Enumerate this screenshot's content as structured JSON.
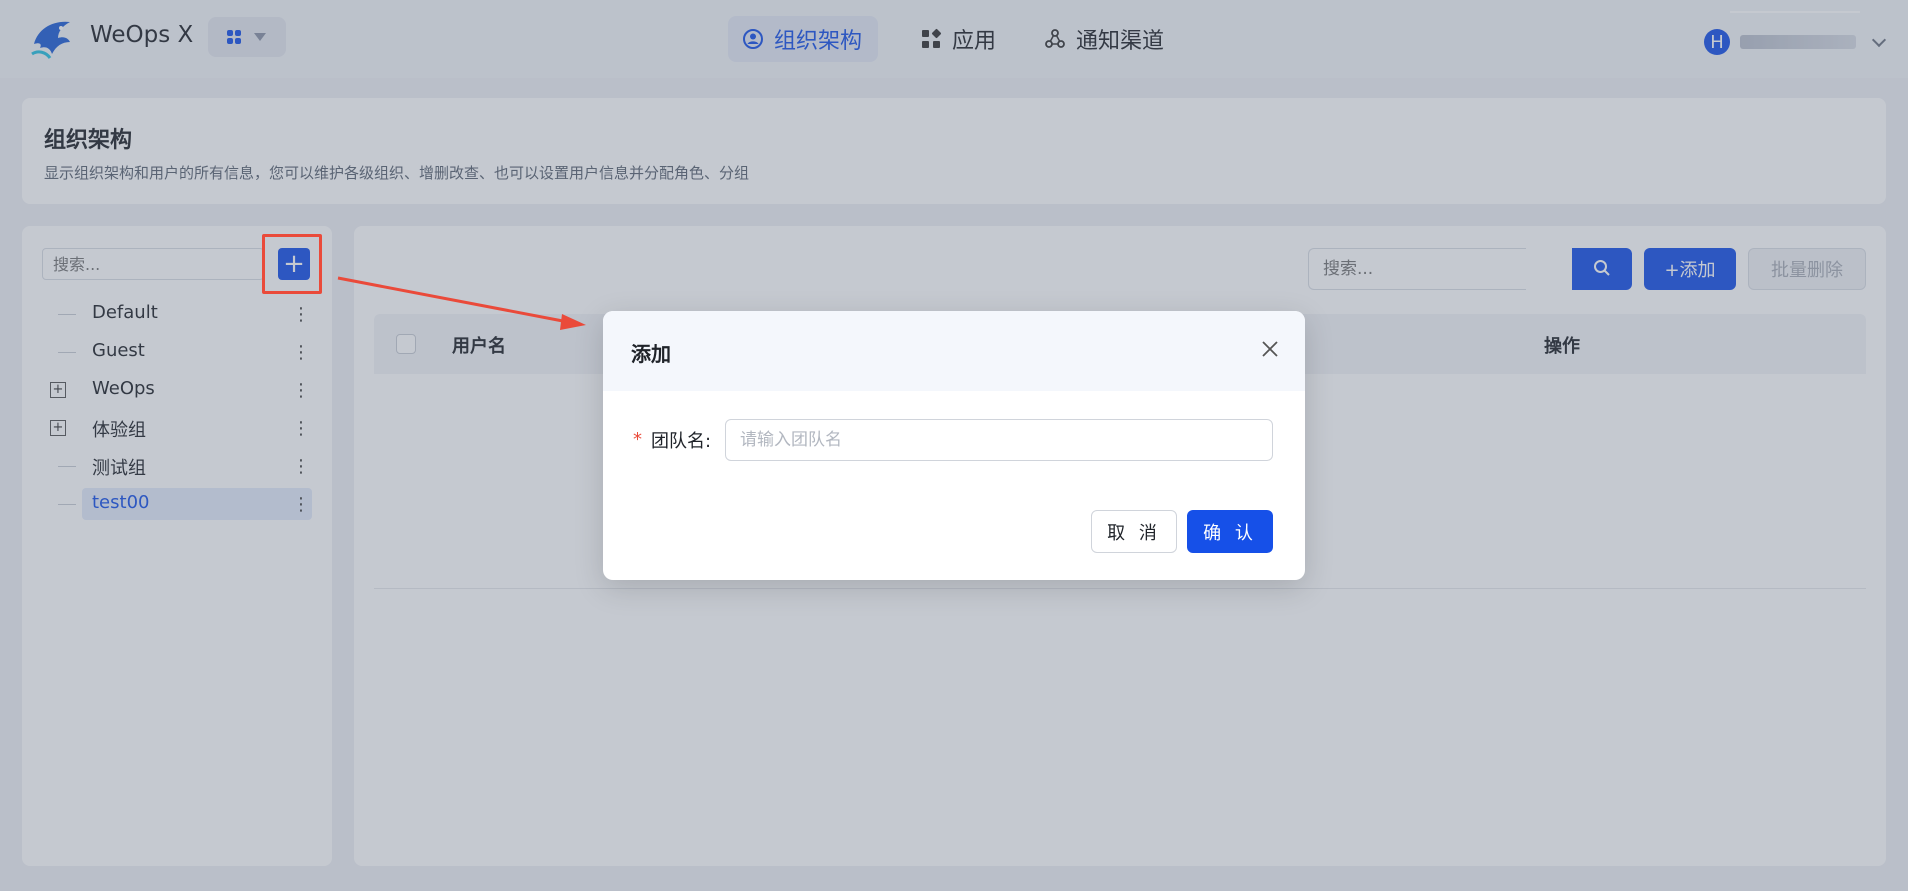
{
  "header": {
    "app_name": "WeOps X",
    "nav": [
      {
        "label": "组织架构",
        "icon": "user-circle-icon",
        "active": true
      },
      {
        "label": "应用",
        "icon": "grid-icon",
        "active": false
      },
      {
        "label": "通知渠道",
        "icon": "share-nodes-icon",
        "active": false
      }
    ],
    "user_initial": "H"
  },
  "intro": {
    "title": "组织架构",
    "description": "显示组织架构和用户的所有信息，您可以维护各级组织、增删改查、也可以设置用户信息并分配角色、分组"
  },
  "tree": {
    "search_placeholder": "搜索...",
    "add_label": "+",
    "nodes": [
      {
        "label": "Default",
        "expandable": false,
        "selected": false
      },
      {
        "label": "Guest",
        "expandable": false,
        "selected": false
      },
      {
        "label": "WeOps",
        "expandable": true,
        "selected": false
      },
      {
        "label": "体验组",
        "expandable": true,
        "selected": false
      },
      {
        "label": "测试组",
        "expandable": false,
        "selected": false
      },
      {
        "label": "test00",
        "expandable": false,
        "selected": true
      }
    ],
    "more_glyph": "⋮",
    "expand_glyph": "+"
  },
  "users": {
    "search_placeholder": "搜索...",
    "add_label": "+添加",
    "batch_delete_label": "批量删除",
    "columns": [
      "用户名",
      "操作"
    ]
  },
  "modal": {
    "title": "添加",
    "required_mark": "*",
    "field_label": "团队名:",
    "field_placeholder": "请输入团队名",
    "field_value": "",
    "cancel_label": "取 消",
    "confirm_label": "确 认"
  },
  "colors": {
    "primary": "#1650e8",
    "annotation": "#ea4a3a",
    "background": "#eef0f5"
  }
}
